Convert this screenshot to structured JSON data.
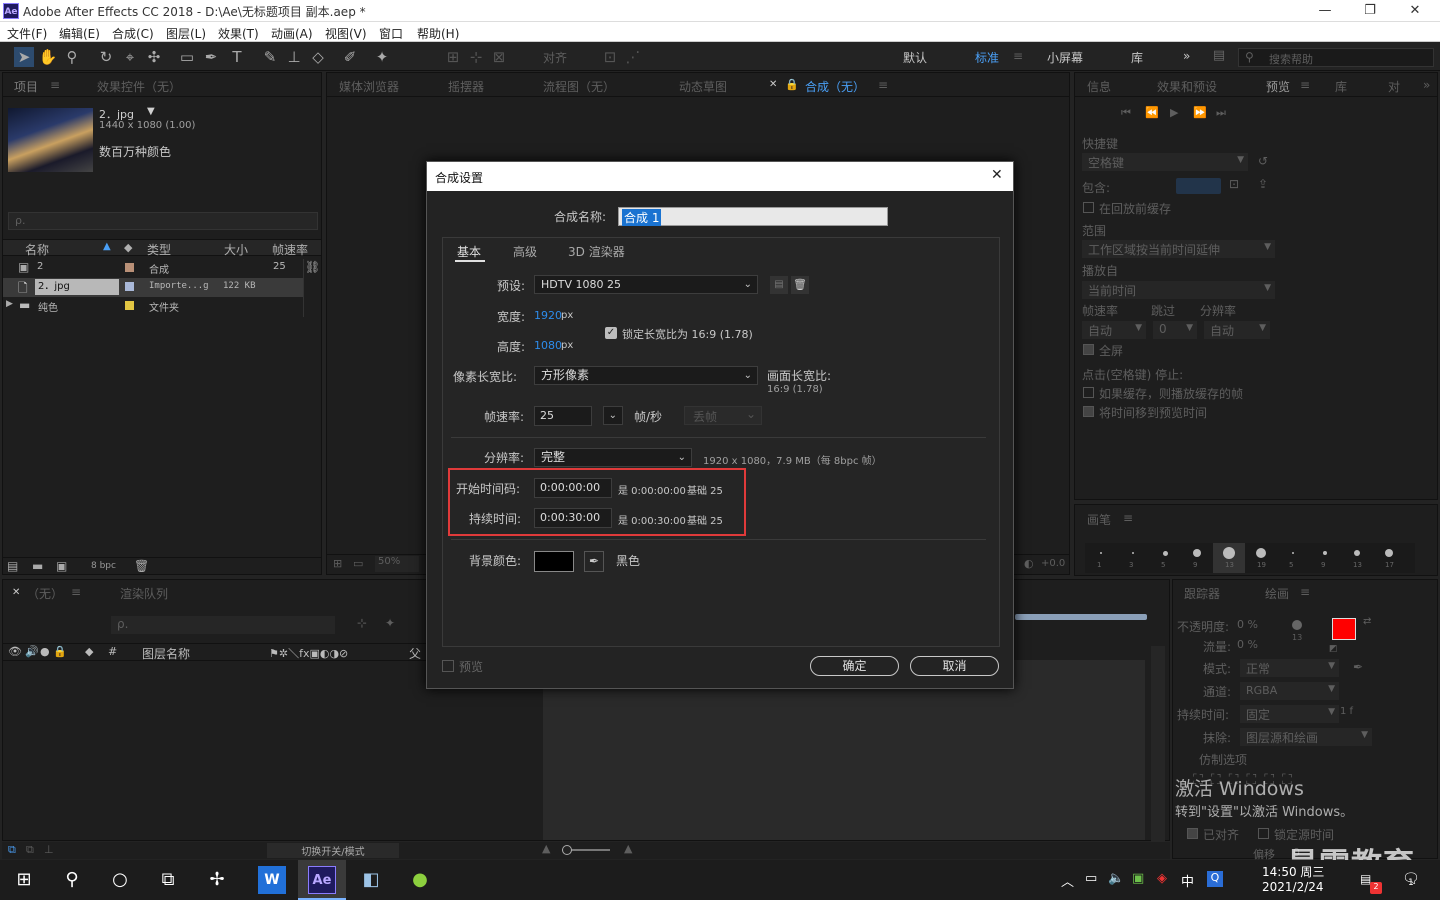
{
  "window": {
    "title": "Adobe After Effects CC 2018 - D:\\Ae\\无标题项目 副本.aep *",
    "logo": "Ae",
    "minimize": "—",
    "restore": "❐",
    "close": "✕"
  },
  "menu": [
    "文件(F)",
    "编辑(E)",
    "合成(C)",
    "图层(L)",
    "效果(T)",
    "动画(A)",
    "视图(V)",
    "窗口",
    "帮助(H)"
  ],
  "toolbar": {
    "snap_label": "对齐",
    "workspaces": [
      "默认",
      "标准",
      "小屏幕",
      "库"
    ],
    "active_workspace": "标准",
    "more": "»",
    "search_placeholder": "搜索帮助"
  },
  "project_panel": {
    "tabs": [
      "项目",
      "效果控件（无）"
    ],
    "selected": {
      "name": "2．jpg",
      "dims": "1440 x 1080 (1.00)",
      "colors": "数百万种颜色"
    },
    "search_placeholder": "ρ.",
    "columns": [
      "名称",
      "类型",
      "大小",
      "帧速率"
    ],
    "rows": [
      {
        "name": "2",
        "type": "合成",
        "size": "",
        "fps": "25",
        "label_color": "#b99077"
      },
      {
        "name": "2．jpg",
        "type": "Importe...g",
        "size": "122 KB",
        "fps": "",
        "label_color": "#a9b8d8"
      },
      {
        "name": "纯色",
        "type": "文件夹",
        "size": "",
        "fps": "",
        "label_color": "#e2c643"
      }
    ],
    "bpc": "8 bpc"
  },
  "viewer_tabs": [
    "媒体浏览器",
    "摇摆器",
    "流程图（无）",
    "动态草图",
    "合成（无）"
  ],
  "viewer": {
    "zoom": "50%",
    "offset": "+0.0"
  },
  "right_panel": {
    "tabs": [
      "信息",
      "效果和预设",
      "预览",
      "库",
      "对"
    ],
    "shortcut_label": "快捷键",
    "shortcut_value": "空格键",
    "include_label": "包含:",
    "cache_before": "在回放前缓存",
    "range_label": "范围",
    "range_value": "工作区域按当前时间延伸",
    "play_from_label": "播放自",
    "play_from_value": "当前时间",
    "fps_label": "帧速率",
    "skip_label": "跳过",
    "res_label": "分辨率",
    "fps_value": "自动",
    "skip_value": "0",
    "res_value": "自动",
    "fullscreen": "全屏",
    "stop_label": "点击(空格键) 停止:",
    "opt1": "如果缓存，则播放缓存的帧",
    "opt2": "将时间移到预览时间"
  },
  "brush_panel": {
    "title": "画笔",
    "sizes": [
      "1",
      "3",
      "5",
      "9",
      "13",
      "19",
      "5",
      "9",
      "13",
      "17"
    ]
  },
  "timeline": {
    "tabs": [
      "（无）",
      "渲染队列"
    ],
    "search_placeholder": "ρ.",
    "col_layer_name": "图层名称",
    "col_parent": "父",
    "col_num": "#",
    "toggle": "切换开关/模式"
  },
  "paint_panel": {
    "tabs": [
      "跟踪器",
      "绘画"
    ],
    "opacity_label": "不透明度:",
    "opacity_value": "0 %",
    "flow_label": "流量:",
    "flow_value": "0 %",
    "mode_label": "模式:",
    "mode_value": "正常",
    "channel_label": "通道:",
    "channel_value": "RGBA",
    "duration_label": "持续时间:",
    "duration_value": "固定",
    "erase_label": "抹除:",
    "erase_value": "图层源和绘画",
    "clone_label": "仿制选项",
    "aligned": "已对齐",
    "lock_source": "锁定源时间",
    "offset_label": "偏移",
    "offset_value": "0",
    "brush_size": "13",
    "dur_frames": "1 f",
    "fg_color": "#ff0000",
    "bg_color": "#ffffff"
  },
  "activation": {
    "line1": "激活 Windows",
    "line2": "转到\"设置\"以激活 Windows。"
  },
  "watermark": "最需教育",
  "dialog": {
    "title": "合成设置",
    "close": "✕",
    "name_label": "合成名称:",
    "name_value": "合成 1",
    "tabs": [
      "基本",
      "高级",
      "3D 渲染器"
    ],
    "active_tab": "基本",
    "preset_label": "预设:",
    "preset_value": "HDTV 1080 25",
    "width_label": "宽度:",
    "width_value": "1920",
    "height_label": "高度:",
    "height_value": "1080",
    "px": "px",
    "lock_ratio": "锁定长宽比为 16:9 (1.78)",
    "par_label": "像素长宽比:",
    "par_value": "方形像素",
    "frame_ratio_label": "画面长宽比:",
    "frame_ratio_value": "16:9 (1.78)",
    "fps_label": "帧速率:",
    "fps_value": "25",
    "fps_unit": "帧/秒",
    "drop_frame": "丢帧",
    "res_label": "分辨率:",
    "res_value": "完整",
    "res_info": "1920 x 1080，7.9 MB（每 8bpc 帧）",
    "start_label": "开始时间码:",
    "start_value": "0:00:00:00",
    "start_info": "是 0:00:00:00",
    "start_base": "基础 25",
    "dur_label": "持续时间:",
    "dur_value": "0:00:30:00",
    "dur_info": "是 0:00:30:00",
    "dur_base": "基础 25",
    "bg_label": "背景颜色:",
    "bg_name": "黑色",
    "bg_color": "#000000",
    "highlight_color": "#e03a3a",
    "preview": "预览",
    "ok": "确定",
    "cancel": "取消"
  },
  "taskbar": {
    "time": "14:50 周三",
    "date": "2021/2/24",
    "ime": "中",
    "notify_count": "1",
    "badge": "2"
  }
}
